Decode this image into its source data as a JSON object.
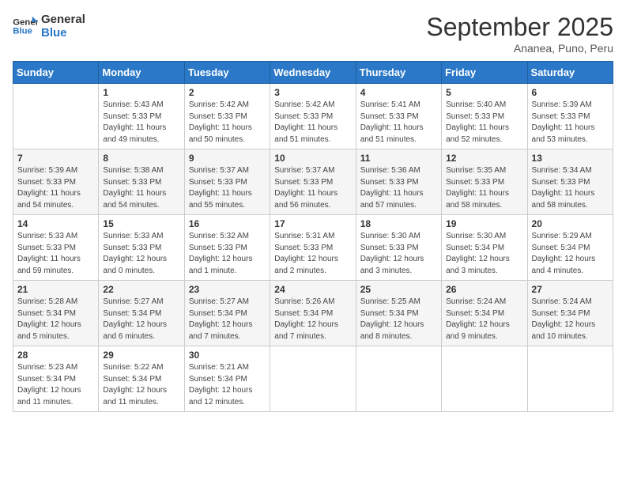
{
  "header": {
    "logo_general": "General",
    "logo_blue": "Blue",
    "month": "September 2025",
    "location": "Ananea, Puno, Peru"
  },
  "weekdays": [
    "Sunday",
    "Monday",
    "Tuesday",
    "Wednesday",
    "Thursday",
    "Friday",
    "Saturday"
  ],
  "weeks": [
    [
      {
        "day": "",
        "info": ""
      },
      {
        "day": "1",
        "info": "Sunrise: 5:43 AM\nSunset: 5:33 PM\nDaylight: 11 hours\nand 49 minutes."
      },
      {
        "day": "2",
        "info": "Sunrise: 5:42 AM\nSunset: 5:33 PM\nDaylight: 11 hours\nand 50 minutes."
      },
      {
        "day": "3",
        "info": "Sunrise: 5:42 AM\nSunset: 5:33 PM\nDaylight: 11 hours\nand 51 minutes."
      },
      {
        "day": "4",
        "info": "Sunrise: 5:41 AM\nSunset: 5:33 PM\nDaylight: 11 hours\nand 51 minutes."
      },
      {
        "day": "5",
        "info": "Sunrise: 5:40 AM\nSunset: 5:33 PM\nDaylight: 11 hours\nand 52 minutes."
      },
      {
        "day": "6",
        "info": "Sunrise: 5:39 AM\nSunset: 5:33 PM\nDaylight: 11 hours\nand 53 minutes."
      }
    ],
    [
      {
        "day": "7",
        "info": "Sunrise: 5:39 AM\nSunset: 5:33 PM\nDaylight: 11 hours\nand 54 minutes."
      },
      {
        "day": "8",
        "info": "Sunrise: 5:38 AM\nSunset: 5:33 PM\nDaylight: 11 hours\nand 54 minutes."
      },
      {
        "day": "9",
        "info": "Sunrise: 5:37 AM\nSunset: 5:33 PM\nDaylight: 11 hours\nand 55 minutes."
      },
      {
        "day": "10",
        "info": "Sunrise: 5:37 AM\nSunset: 5:33 PM\nDaylight: 11 hours\nand 56 minutes."
      },
      {
        "day": "11",
        "info": "Sunrise: 5:36 AM\nSunset: 5:33 PM\nDaylight: 11 hours\nand 57 minutes."
      },
      {
        "day": "12",
        "info": "Sunrise: 5:35 AM\nSunset: 5:33 PM\nDaylight: 11 hours\nand 58 minutes."
      },
      {
        "day": "13",
        "info": "Sunrise: 5:34 AM\nSunset: 5:33 PM\nDaylight: 11 hours\nand 58 minutes."
      }
    ],
    [
      {
        "day": "14",
        "info": "Sunrise: 5:33 AM\nSunset: 5:33 PM\nDaylight: 11 hours\nand 59 minutes."
      },
      {
        "day": "15",
        "info": "Sunrise: 5:33 AM\nSunset: 5:33 PM\nDaylight: 12 hours\nand 0 minutes."
      },
      {
        "day": "16",
        "info": "Sunrise: 5:32 AM\nSunset: 5:33 PM\nDaylight: 12 hours\nand 1 minute."
      },
      {
        "day": "17",
        "info": "Sunrise: 5:31 AM\nSunset: 5:33 PM\nDaylight: 12 hours\nand 2 minutes."
      },
      {
        "day": "18",
        "info": "Sunrise: 5:30 AM\nSunset: 5:33 PM\nDaylight: 12 hours\nand 3 minutes."
      },
      {
        "day": "19",
        "info": "Sunrise: 5:30 AM\nSunset: 5:34 PM\nDaylight: 12 hours\nand 3 minutes."
      },
      {
        "day": "20",
        "info": "Sunrise: 5:29 AM\nSunset: 5:34 PM\nDaylight: 12 hours\nand 4 minutes."
      }
    ],
    [
      {
        "day": "21",
        "info": "Sunrise: 5:28 AM\nSunset: 5:34 PM\nDaylight: 12 hours\nand 5 minutes."
      },
      {
        "day": "22",
        "info": "Sunrise: 5:27 AM\nSunset: 5:34 PM\nDaylight: 12 hours\nand 6 minutes."
      },
      {
        "day": "23",
        "info": "Sunrise: 5:27 AM\nSunset: 5:34 PM\nDaylight: 12 hours\nand 7 minutes."
      },
      {
        "day": "24",
        "info": "Sunrise: 5:26 AM\nSunset: 5:34 PM\nDaylight: 12 hours\nand 7 minutes."
      },
      {
        "day": "25",
        "info": "Sunrise: 5:25 AM\nSunset: 5:34 PM\nDaylight: 12 hours\nand 8 minutes."
      },
      {
        "day": "26",
        "info": "Sunrise: 5:24 AM\nSunset: 5:34 PM\nDaylight: 12 hours\nand 9 minutes."
      },
      {
        "day": "27",
        "info": "Sunrise: 5:24 AM\nSunset: 5:34 PM\nDaylight: 12 hours\nand 10 minutes."
      }
    ],
    [
      {
        "day": "28",
        "info": "Sunrise: 5:23 AM\nSunset: 5:34 PM\nDaylight: 12 hours\nand 11 minutes."
      },
      {
        "day": "29",
        "info": "Sunrise: 5:22 AM\nSunset: 5:34 PM\nDaylight: 12 hours\nand 11 minutes."
      },
      {
        "day": "30",
        "info": "Sunrise: 5:21 AM\nSunset: 5:34 PM\nDaylight: 12 hours\nand 12 minutes."
      },
      {
        "day": "",
        "info": ""
      },
      {
        "day": "",
        "info": ""
      },
      {
        "day": "",
        "info": ""
      },
      {
        "day": "",
        "info": ""
      }
    ]
  ]
}
